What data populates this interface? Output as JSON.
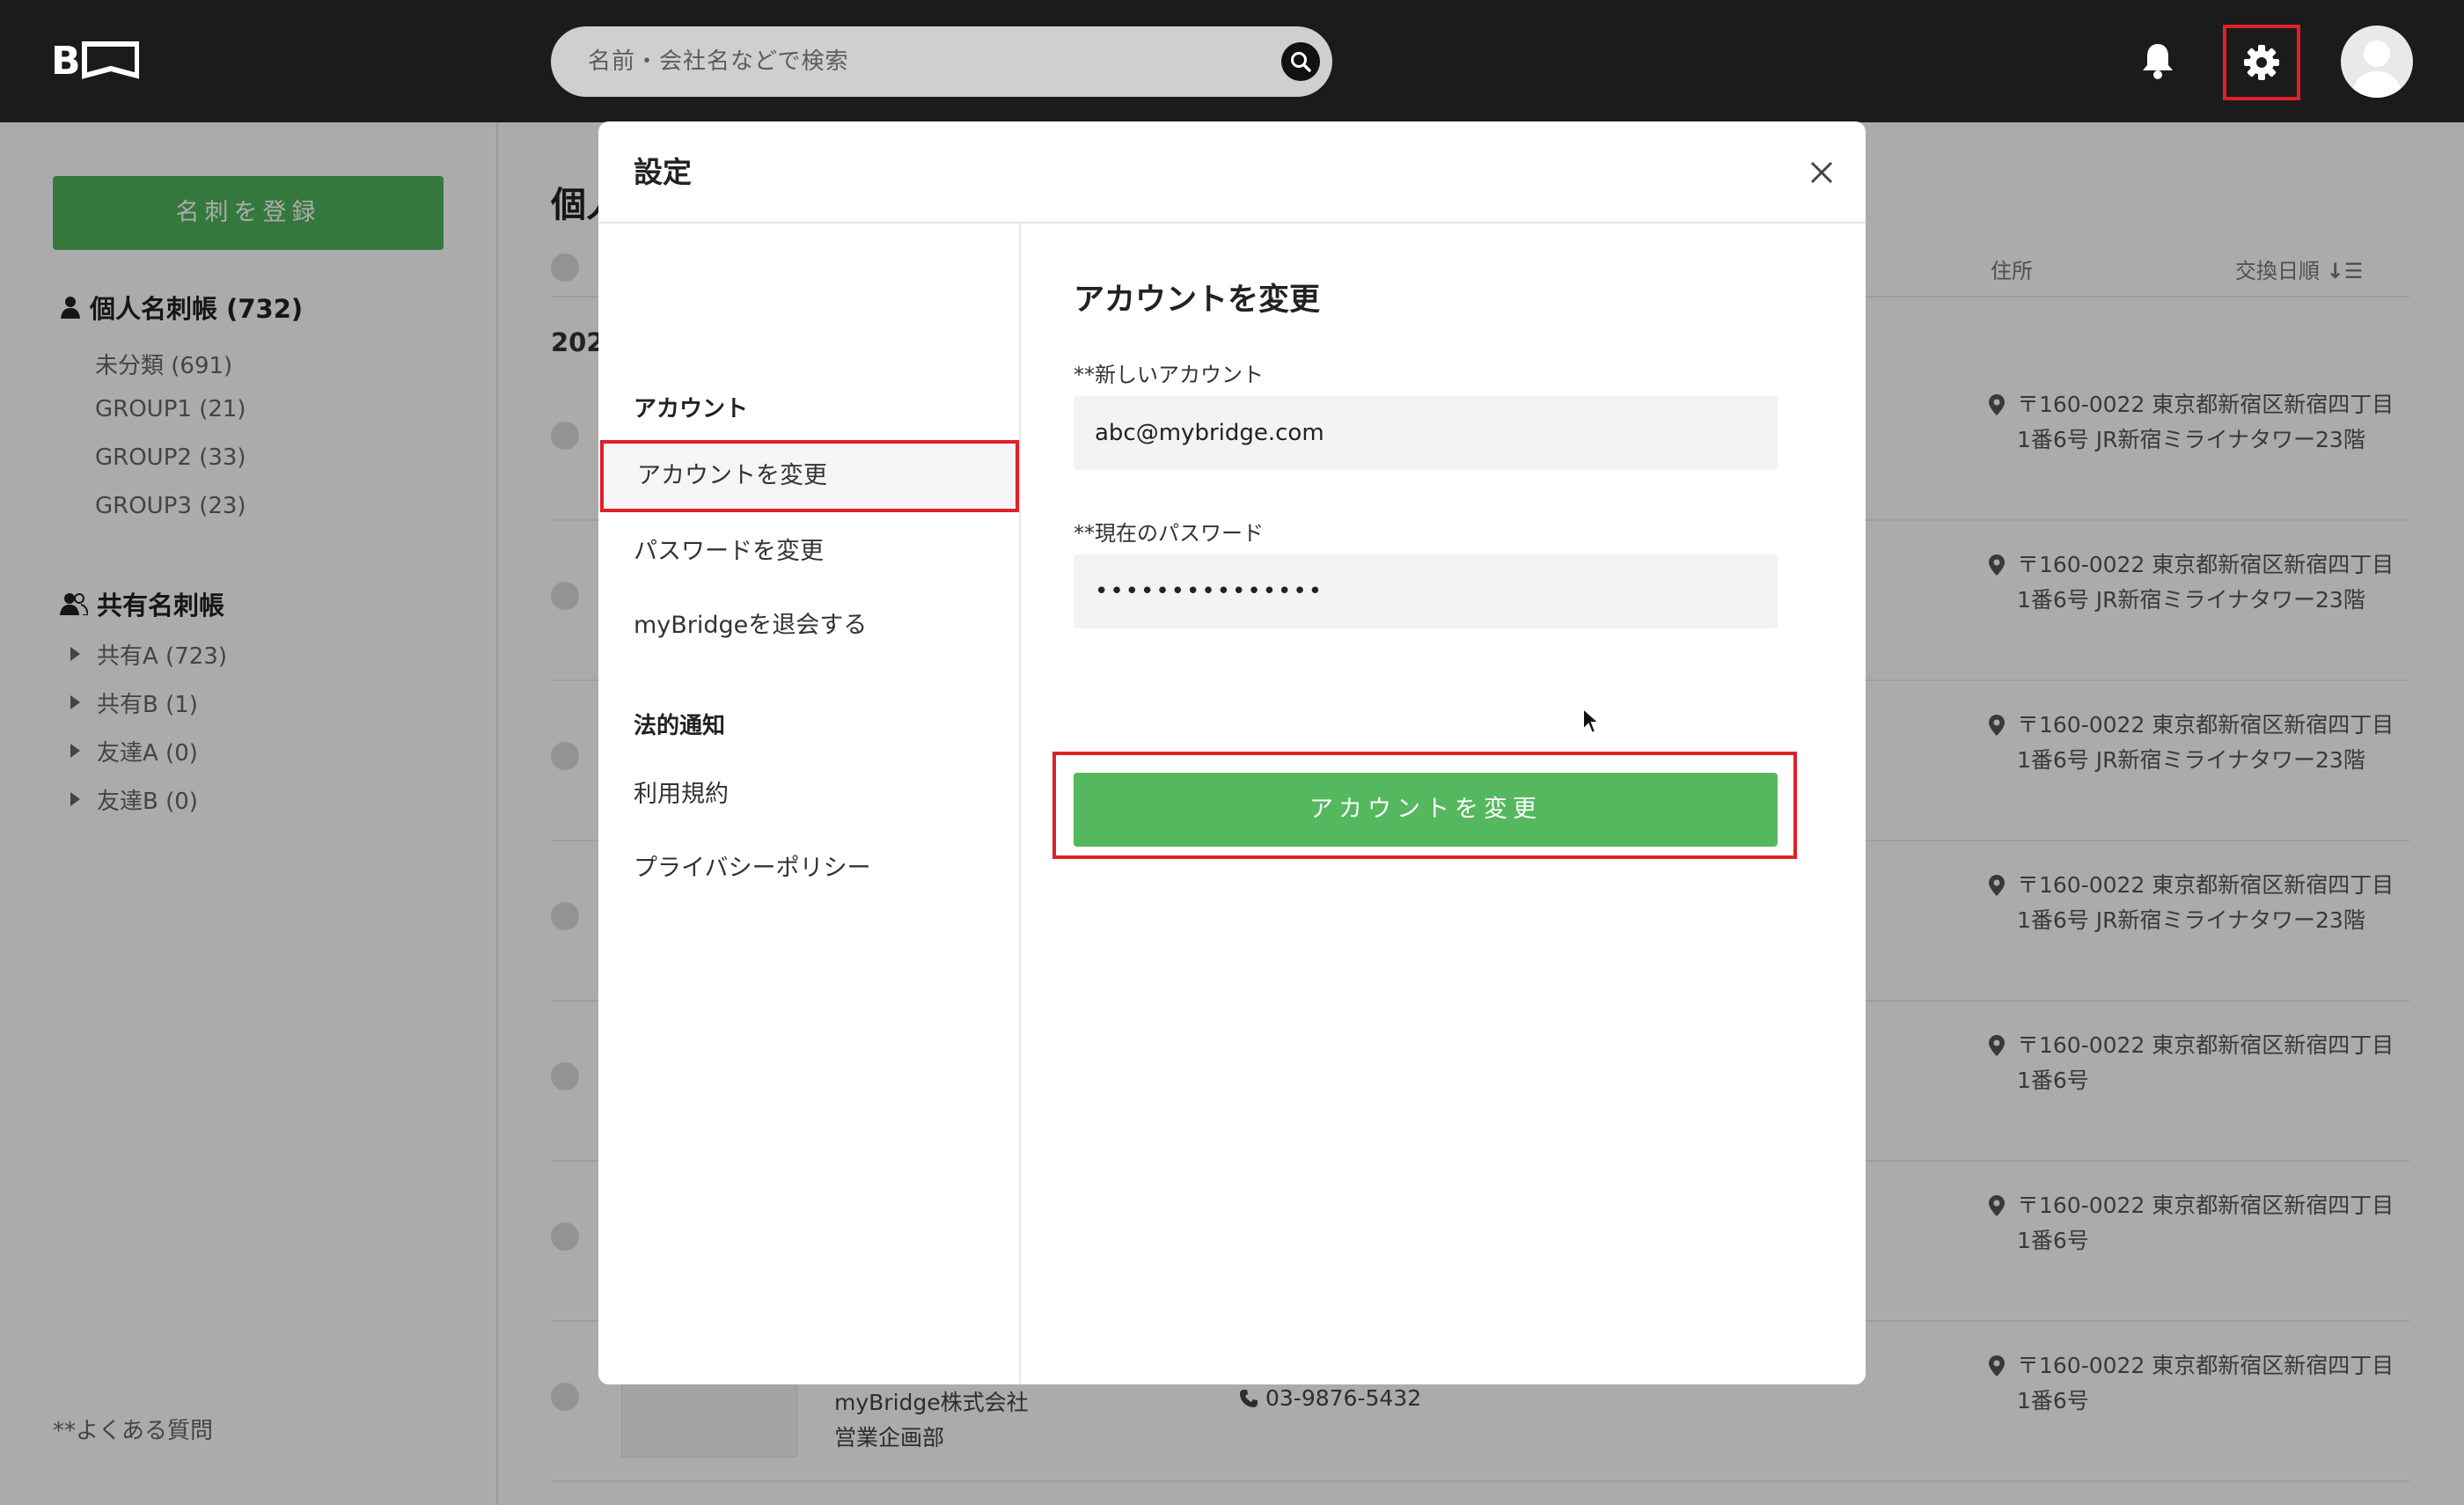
{
  "header": {
    "logo_text": "B",
    "search_placeholder": "名前・会社名などで検索"
  },
  "sidebar": {
    "register_label": "名刺を登録",
    "personal_title": "個人名刺帳 (732)",
    "personal_groups": [
      "未分類 (691)",
      "GROUP1 (21)",
      "GROUP2 (33)",
      "GROUP3 (23)"
    ],
    "shared_title": "共有名刺帳",
    "shared_groups": [
      "共有A (723)",
      "共有B (1)",
      "友達A (0)",
      "友達B (0)"
    ],
    "faq_label": "**よくある質問"
  },
  "main": {
    "title_partial": "個人",
    "year_partial": "202",
    "columns": {
      "address": "住所",
      "date": "交換日順"
    },
    "addresses": [
      [
        "〒160-0022 東京都新宿区新宿四丁目",
        "1番6号 JR新宿ミライナタワー23階"
      ],
      [
        "〒160-0022 東京都新宿区新宿四丁目",
        "1番6号 JR新宿ミライナタワー23階"
      ],
      [
        "〒160-0022 東京都新宿区新宿四丁目",
        "1番6号 JR新宿ミライナタワー23階"
      ],
      [
        "〒160-0022 東京都新宿区新宿四丁目",
        "1番6号 JR新宿ミライナタワー23階"
      ],
      [
        "〒160-0022 東京都新宿区新宿四丁目",
        "1番6号"
      ],
      [
        "〒160-0022 東京都新宿区新宿四丁目",
        "1番6号"
      ],
      [
        "〒160-0022 東京都新宿区新宿四丁目",
        "1番6号"
      ]
    ],
    "last_row": {
      "company": "myBridge株式会社",
      "department": "営業企画部",
      "phone": "03-9876-5432"
    }
  },
  "modal": {
    "title": "設定",
    "nav": {
      "account_group": "アカウント",
      "items": [
        "アカウントを変更",
        "パスワードを変更",
        "myBridgeを退会する"
      ],
      "legal_group": "法的通知",
      "legal_items": [
        "利用規約",
        "プライバシーポリシー"
      ]
    },
    "body": {
      "title": "アカウントを変更",
      "new_account_label": "**新しいアカウント",
      "new_account_value": "abc@mybridge.com",
      "password_label": "**現在のパスワード",
      "password_value": "•••••••••••••••",
      "submit_label": "アカウントを変更"
    }
  },
  "colors": {
    "accent_green": "#56b85e",
    "highlight_red": "#e0202a",
    "header_bg": "#1b1b1b"
  }
}
